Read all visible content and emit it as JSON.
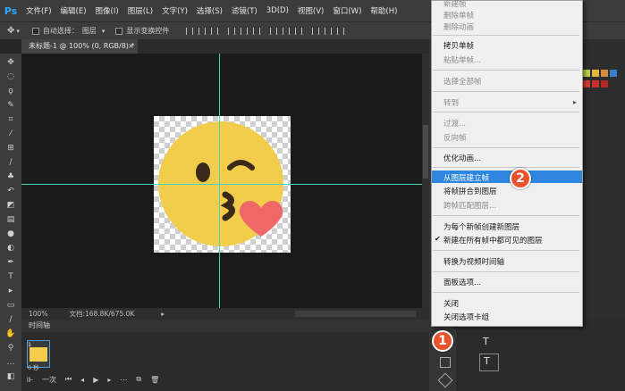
{
  "app": {
    "logo": "Ps"
  },
  "menubar": {
    "items": [
      "文件(F)",
      "编辑(E)",
      "图像(I)",
      "图层(L)",
      "文字(Y)",
      "选择(S)",
      "滤镜(T)",
      "3D(D)",
      "视图(V)",
      "窗口(W)",
      "帮助(H)"
    ]
  },
  "options": {
    "auto_select_label": "自动选择：",
    "auto_select_value": "图层",
    "show_transform_label": "显示变换控件"
  },
  "document": {
    "tab_title": "未标题-1 @ 100% (0, RGB/8) *"
  },
  "status": {
    "zoom": "100%",
    "doc_info": "文档:168.8K/675.0K"
  },
  "timeline": {
    "title": "时间轴",
    "frame_number": "1",
    "frame_delay": "0 秒",
    "loop": "一次"
  },
  "context_menu": {
    "items": [
      {
        "label": "新建帧",
        "disabled": true
      },
      {
        "label": "删除单帧",
        "disabled": true
      },
      {
        "label": "删除动画",
        "disabled": true
      },
      {
        "label": "拷贝单帧",
        "disabled": false
      },
      {
        "label": "粘贴单帧...",
        "disabled": true
      },
      {
        "label": "选择全部帧",
        "disabled": true
      },
      {
        "label": "转到",
        "disabled": true,
        "submenu": true
      },
      {
        "label": "过渡...",
        "disabled": true
      },
      {
        "label": "反向帧",
        "disabled": true
      },
      {
        "label": "优化动画...",
        "disabled": false
      },
      {
        "label": "从图层建立帧",
        "disabled": false,
        "highlighted": true
      },
      {
        "label": "将帧拼合到图层",
        "disabled": false
      },
      {
        "label": "跨帧匹配图层...",
        "disabled": true
      },
      {
        "label": "为每个新帧创建新图层",
        "disabled": false
      },
      {
        "label": "新建在所有帧中都可见的图层",
        "disabled": false,
        "checked": true
      },
      {
        "label": "转换为视频时间轴",
        "disabled": false
      },
      {
        "label": "面板选项...",
        "disabled": false
      },
      {
        "label": "关闭",
        "disabled": false
      },
      {
        "label": "关闭选项卡组",
        "disabled": false
      }
    ]
  },
  "badges": {
    "one": "1",
    "two": "2"
  },
  "layers": {
    "row1_icon": "T",
    "row2_icon": "T"
  },
  "colors": {
    "accent": "#2e86de",
    "guide": "#3fd6c0",
    "badge": "#e8532b",
    "emoji_face": "#f1cd4b",
    "heart": "#f06767"
  }
}
